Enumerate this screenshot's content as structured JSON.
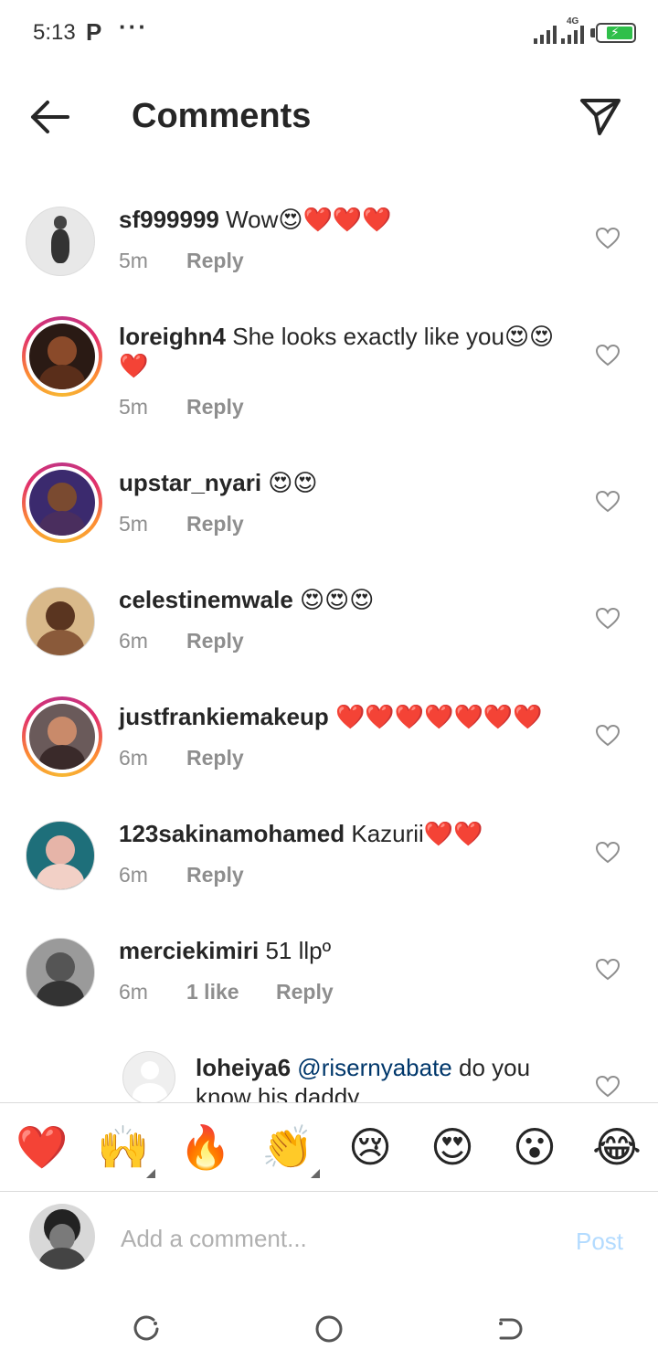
{
  "status_bar": {
    "time": "5:13",
    "app_indicator": "P",
    "more": "···",
    "network": "4G",
    "battery_level": "charging",
    "accent_battery": "#2fbf4a"
  },
  "header": {
    "title": "Comments",
    "back_icon": "back-arrow-icon",
    "share_icon": "send-icon"
  },
  "comments": [
    {
      "username": "sf999999",
      "text": " Wow😍❤️❤️❤️",
      "time": "5m",
      "likes": "",
      "reply": "Reply",
      "story_ring": false
    },
    {
      "username": "loreighn4",
      "text": " She looks exactly like you😍😍❤️",
      "time": "5m",
      "likes": "",
      "reply": "Reply",
      "story_ring": true
    },
    {
      "username": "upstar_nyari",
      "text": " 😍😍",
      "time": "5m",
      "likes": "",
      "reply": "Reply",
      "story_ring": true
    },
    {
      "username": "celestinemwale",
      "text": " 😍😍😍",
      "time": "6m",
      "likes": "",
      "reply": "Reply",
      "story_ring": false
    },
    {
      "username": "justfrankiemakeup",
      "text": " ❤️❤️❤️❤️❤️❤️❤️",
      "time": "6m",
      "likes": "",
      "reply": "Reply",
      "story_ring": true
    },
    {
      "username": "123sakinamohamed",
      "text": " Kazurii❤️❤️",
      "time": "6m",
      "likes": "",
      "reply": "Reply",
      "story_ring": false
    },
    {
      "username": "merciekimiri",
      "text": " 51 llpº",
      "time": "6m",
      "likes": "1 like",
      "reply": "Reply",
      "story_ring": false
    }
  ],
  "reply_comment": {
    "username": "loheiya6",
    "mention": "@risernyabate",
    "text": " do you know his daddy"
  },
  "emoji_bar": [
    "❤️",
    "🙌",
    "🔥",
    "👏",
    "😢",
    "😍",
    "😮",
    "😂"
  ],
  "input": {
    "placeholder": "Add a comment...",
    "value": "",
    "post_label": "Post",
    "post_color": "#b3dbff"
  },
  "nav_bar": {
    "icons": [
      "recent-apps-icon",
      "home-icon",
      "back-icon"
    ]
  }
}
